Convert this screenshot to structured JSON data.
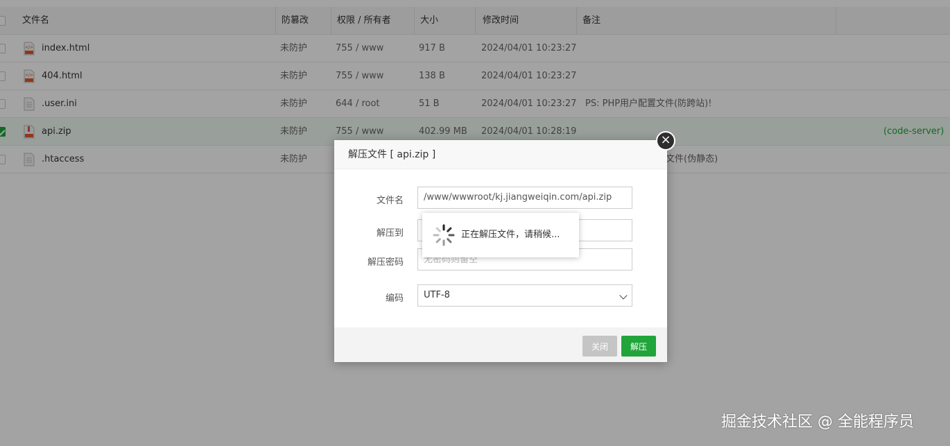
{
  "table": {
    "headers": [
      "文件名",
      "防篡改",
      "权限 / 所有者",
      "大小",
      "修改时间",
      "备注"
    ],
    "rows": [
      {
        "name": "index.html",
        "protect": "未防护",
        "perm": "755 / www",
        "size": "917 B",
        "mtime": "2024/04/01 10:23:27",
        "remark": "",
        "checked": false,
        "icon": "html-file-icon"
      },
      {
        "name": "404.html",
        "protect": "未防护",
        "perm": "755 / www",
        "size": "138 B",
        "mtime": "2024/04/01 10:23:27",
        "remark": "",
        "checked": false,
        "icon": "html-file-icon"
      },
      {
        "name": ".user.ini",
        "protect": "未防护",
        "perm": "644 / root",
        "size": "51 B",
        "mtime": "2024/04/01 10:23:27",
        "remark": "PS: PHP用户配置文件(防跨站)!",
        "checked": false,
        "icon": "text-file-icon"
      },
      {
        "name": "api.zip",
        "protect": "未防护",
        "perm": "755 / www",
        "size": "402.99 MB",
        "mtime": "2024/04/01 10:28:19",
        "remark": "",
        "checked": true,
        "icon": "zip-file-icon",
        "extra": "(code-server)"
      },
      {
        "name": ".htaccess",
        "protect": "未防护",
        "perm": "",
        "size": "",
        "mtime": "",
        "remark": "文件(伪静态)",
        "checked": false,
        "icon": "text-file-icon"
      }
    ]
  },
  "dialog": {
    "title": "解压文件 [ api.zip ]",
    "close_icon": "close-icon",
    "fields": {
      "filename_label": "文件名",
      "filename_value": "/www/wwwroot/kj.jiangweiqin.com/api.zip",
      "target_label": "解压到",
      "target_value": "",
      "password_label": "解压密码",
      "password_placeholder": "无密码则留空",
      "encoding_label": "编码",
      "encoding_value": "UTF-8"
    },
    "buttons": {
      "close": "关闭",
      "unzip": "解压"
    }
  },
  "loading": {
    "text": "正在解压文件，请稍候..."
  },
  "watermark": "掘金技术社区 @ 全能程序员",
  "colors": {
    "accent": "#20a53a",
    "overlay": "rgba(0,0,0,0.36)"
  }
}
